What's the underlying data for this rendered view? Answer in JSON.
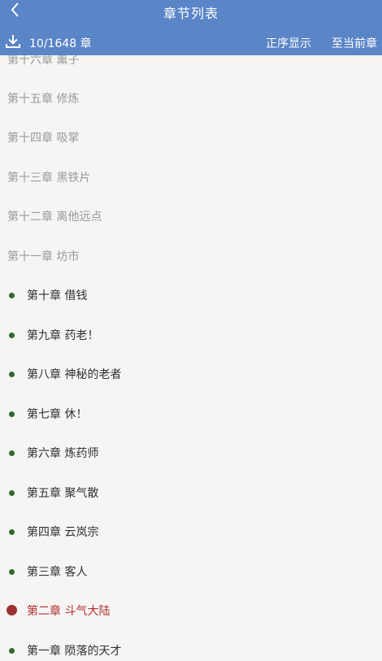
{
  "header": {
    "title": "章节列表",
    "count": "10/1648 章",
    "sort_label": "正序显示",
    "goto_current_label": "至当前章"
  },
  "chapters": [
    {
      "label": "第十六章 薰子",
      "state": "uncached"
    },
    {
      "label": "第十五章 修炼",
      "state": "uncached"
    },
    {
      "label": "第十四章 吸掌",
      "state": "uncached"
    },
    {
      "label": "第十三章 黑铁片",
      "state": "uncached"
    },
    {
      "label": "第十二章 离他远点",
      "state": "uncached"
    },
    {
      "label": "第十一章 坊市",
      "state": "uncached"
    },
    {
      "label": "第十章 借钱",
      "state": "cached"
    },
    {
      "label": "第九章 药老！",
      "state": "cached"
    },
    {
      "label": "第八章 神秘的老者",
      "state": "cached"
    },
    {
      "label": "第七章 休！",
      "state": "cached"
    },
    {
      "label": "第六章 炼药师",
      "state": "cached"
    },
    {
      "label": "第五章 聚气散",
      "state": "cached"
    },
    {
      "label": "第四章 云岚宗",
      "state": "cached"
    },
    {
      "label": "第三章 客人",
      "state": "cached"
    },
    {
      "label": "第二章 斗气大陆",
      "state": "current"
    },
    {
      "label": "第一章 陨落的天才",
      "state": "cached"
    }
  ],
  "colors": {
    "header_bg": "#5a85c7",
    "cached_dot": "#2f6b2f",
    "current": "#9e2f2f",
    "uncached_text": "#9a9a9a"
  },
  "icons": {
    "back": "chevron-left-icon",
    "download": "download-icon",
    "cached_marker": "dot-icon"
  }
}
